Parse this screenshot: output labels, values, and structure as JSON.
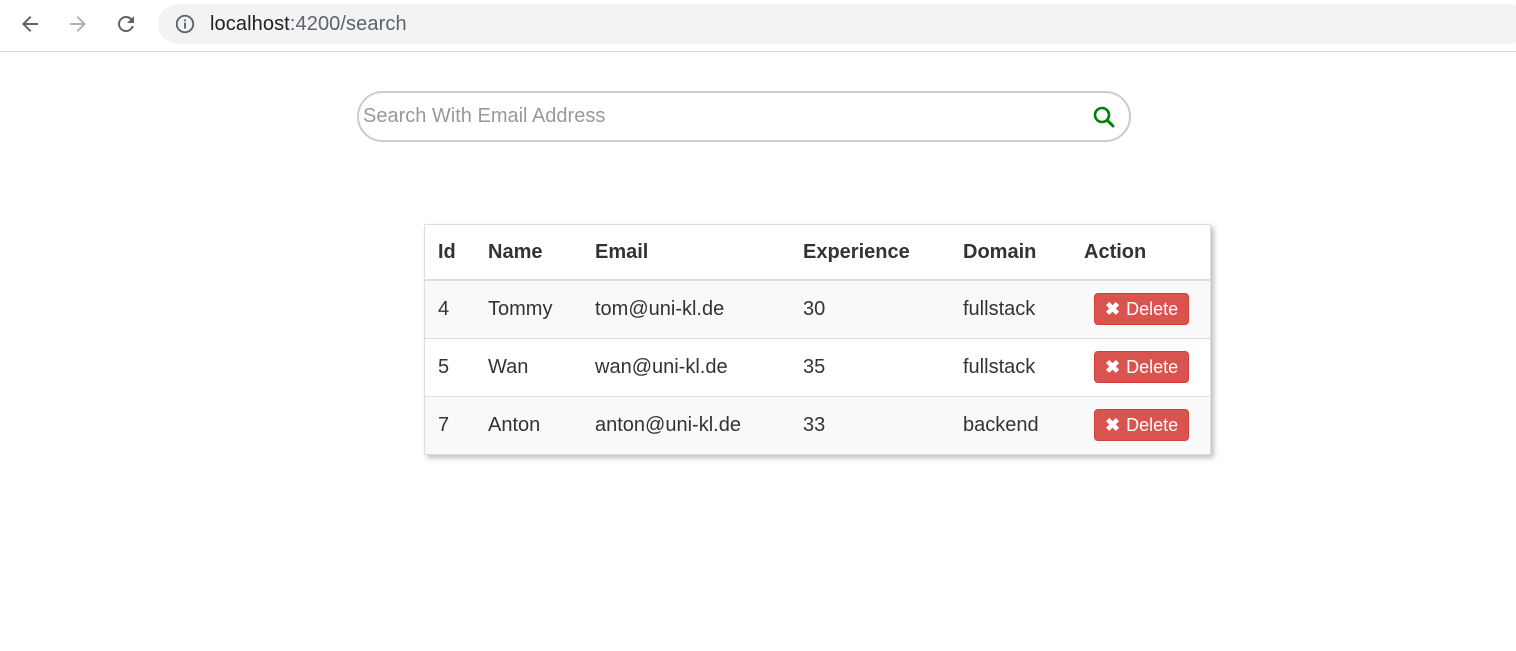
{
  "browser": {
    "url_host": "localhost",
    "url_path": ":4200/search",
    "back_icon": "arrow-left-icon",
    "forward_icon": "arrow-right-icon",
    "reload_icon": "reload-icon",
    "info_icon": "info-icon"
  },
  "search": {
    "placeholder": "Search With Email Address",
    "value": "",
    "icon": "search-icon",
    "icon_color": "#008000"
  },
  "table": {
    "headers": [
      "Id",
      "Name",
      "Email",
      "Experience",
      "Domain",
      "Action"
    ],
    "rows": [
      {
        "id": "4",
        "name": "Tommy",
        "email": "tom@uni-kl.de",
        "experience": "30",
        "domain": "fullstack",
        "action": "Delete"
      },
      {
        "id": "5",
        "name": "Wan",
        "email": "wan@uni-kl.de",
        "experience": "35",
        "domain": "fullstack",
        "action": "Delete"
      },
      {
        "id": "7",
        "name": "Anton",
        "email": "anton@uni-kl.de",
        "experience": "33",
        "domain": "backend",
        "action": "Delete"
      }
    ],
    "delete_color": "#d9534f"
  }
}
